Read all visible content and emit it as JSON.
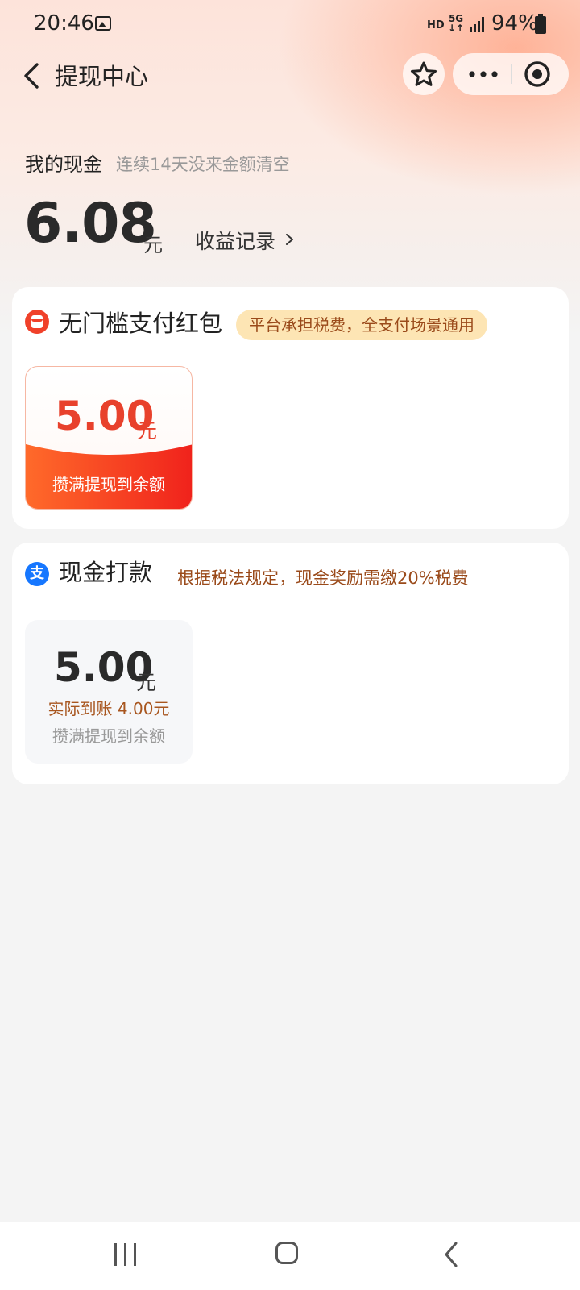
{
  "status_bar": {
    "time": "20:46",
    "network_hd": "HD",
    "network_5g": "5G",
    "battery": "94%"
  },
  "nav": {
    "title": "提现中心",
    "icons": [
      "back-chevron-icon",
      "star-icon",
      "more-dots-icon",
      "target-icon"
    ]
  },
  "cash": {
    "label": "我的现金",
    "tip": "连续14天没来金额清空",
    "amount": "6.08",
    "unit": "元",
    "records_label": "收益记录"
  },
  "redpacket_section": {
    "title": "无门槛支付红包",
    "badge": "平台承担税费，全支付场景通用",
    "option": {
      "amount": "5.00",
      "unit": "元",
      "caption": "攒满提现到余额"
    }
  },
  "cash_transfer_section": {
    "title": "现金打款",
    "note": "根据税法规定，现金奖励需缴20%税费",
    "icon_text": "支",
    "option": {
      "amount": "5.00",
      "unit": "元",
      "actual": "实际到账 4.00元",
      "caption": "攒满提现到余额"
    }
  },
  "colors": {
    "accent_red": "#e8412c",
    "badge_bg": "#fde5b4",
    "badge_text": "#9a4a1a",
    "alipay_blue": "#1677ff"
  }
}
